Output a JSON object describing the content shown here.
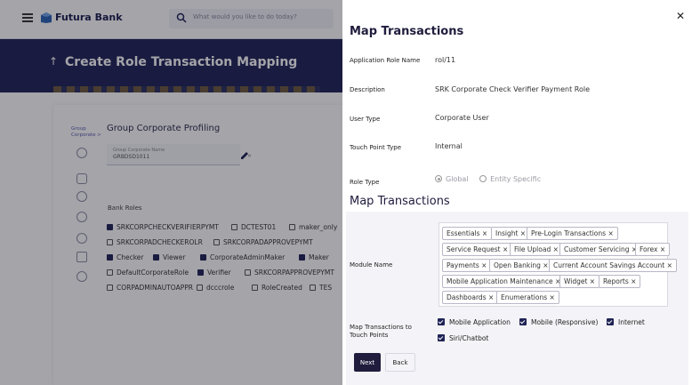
{
  "header": {
    "app_name": "Futura Bank",
    "search_placeholder": "What would you like to do today?"
  },
  "page": {
    "title": "Create Role Transaction Mapping",
    "breadcrumb": "Group Corporate >",
    "section_title": "Group Corporate Profiling",
    "group_corporate_label": "Group Corporate Name",
    "group_corporate_value": "GRBDSD1011",
    "bank_roles_label": "Bank Roles",
    "roles": [
      {
        "label": "SRKCORPCHECKVERIFIERPYMT",
        "checked": true
      },
      {
        "label": "DCTEST01",
        "checked": false
      },
      {
        "label": "maker_only",
        "checked": false
      },
      {
        "label": "SRKCORPADCHECKEROLR",
        "checked": false
      },
      {
        "label": "SRKCORPADAPPROVEPYMT",
        "checked": false
      },
      {
        "label": "Checker",
        "checked": true
      },
      {
        "label": "Viewer",
        "checked": true
      },
      {
        "label": "CorporateAdminMaker",
        "checked": true
      },
      {
        "label": "Maker",
        "checked": true
      },
      {
        "label": "DefaultCorporateRole",
        "checked": false
      },
      {
        "label": "Verifier",
        "checked": true
      },
      {
        "label": "SRKCORPAPPROVEPYMT",
        "checked": false
      },
      {
        "label": "CORPADMINAUTOAPPR",
        "checked": false
      },
      {
        "label": "dcccrole",
        "checked": false
      },
      {
        "label": "RoleCreated",
        "checked": false
      },
      {
        "label": "TES",
        "checked": false
      }
    ]
  },
  "drawer": {
    "title": "Map Transactions",
    "close_icon": "close-icon",
    "fields": {
      "application_role_name": {
        "label": "Application Role Name",
        "value": "rol/11"
      },
      "description": {
        "label": "Description",
        "value": "SRK Corporate Check Verifier Payment Role"
      },
      "user_type": {
        "label": "User Type",
        "value": "Corporate User"
      },
      "touch_point_type": {
        "label": "Touch Point Type",
        "value": "Internal"
      },
      "role_type": {
        "label": "Role Type",
        "options": [
          "Global",
          "Entity Specific"
        ],
        "selected": "Global"
      }
    },
    "subheading": "Map Transactions",
    "module_name_label": "Module Name",
    "modules": [
      "Essentials ×",
      "Insight ×",
      "Pre-Login Transactions ×",
      "Service Request ×",
      "File Upload ×",
      "Customer Servicing ×",
      "Forex ×",
      "Payments ×",
      "Open Banking ×",
      "Current Account Savings Account ×",
      "Mobile Application Maintenance ×",
      "Widget ×",
      "Reports ×",
      "Dashboards ×",
      "Enumerations ×"
    ],
    "touch_points_label": "Map Transactions to Touch Points",
    "touch_points": [
      "Mobile Application",
      "Mobile (Responsive)",
      "Internet",
      "Siri/Chatbot"
    ],
    "buttons": {
      "next": "Next",
      "back": "Back"
    }
  }
}
